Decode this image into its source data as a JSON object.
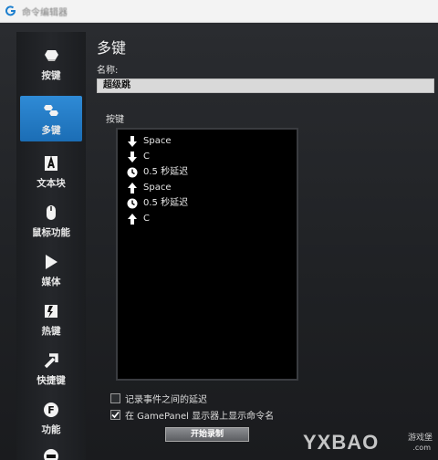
{
  "window": {
    "title": "命令编辑器"
  },
  "sidebar": {
    "items": [
      {
        "label": "按键",
        "icon": "key-icon",
        "active": false
      },
      {
        "label": "多键",
        "icon": "multikey-icon",
        "active": true
      },
      {
        "label": "文本块",
        "icon": "text-block-icon",
        "active": false
      },
      {
        "label": "鼠标功能",
        "icon": "mouse-icon",
        "active": false
      },
      {
        "label": "媒体",
        "icon": "play-icon",
        "active": false
      },
      {
        "label": "热键",
        "icon": "hotkey-icon",
        "active": false
      },
      {
        "label": "快捷键",
        "icon": "shortcut-arrow-icon",
        "active": false
      },
      {
        "label": "功能",
        "icon": "function-icon",
        "active": false
      },
      {
        "label": "",
        "icon": "gamepanel-icon",
        "active": false
      }
    ]
  },
  "main": {
    "heading": "多键",
    "name_label": "名称:",
    "name_value": "超级跳",
    "keys_label": "按键",
    "keys": [
      {
        "icon": "arrow-down-icon",
        "text": "Space"
      },
      {
        "icon": "arrow-down-icon",
        "text": "C"
      },
      {
        "icon": "clock-icon",
        "text": "0.5 秒延迟"
      },
      {
        "icon": "arrow-up-icon",
        "text": "Space"
      },
      {
        "icon": "clock-icon",
        "text": "0.5 秒延迟"
      },
      {
        "icon": "arrow-up-icon",
        "text": "C"
      }
    ],
    "record_delay_label": "记录事件之间的延迟",
    "record_delay_checked": false,
    "show_gamepanel_label": "在 GamePanel 显示器上显示命令名",
    "show_gamepanel_checked": true,
    "record_button": "开始录制"
  },
  "watermark": {
    "brand": "YXBAO",
    "sub": "游戏堡",
    "site": ".com"
  },
  "colors": {
    "accent": "#2f8bd6",
    "list_bg": "#000000",
    "panel_bg": "#1f2124"
  }
}
